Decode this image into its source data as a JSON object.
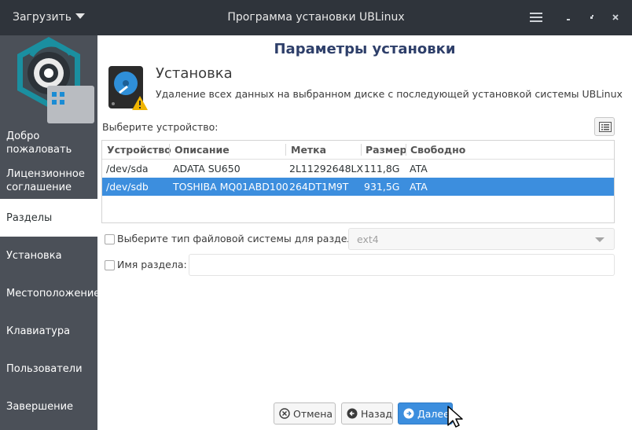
{
  "titlebar": {
    "load_menu": "Загрузить",
    "title": "Программа установки UBLinux",
    "minimize": "˯",
    "maximize": "˰",
    "close": "✕"
  },
  "sidebar": {
    "items": [
      {
        "label": "Добро\nпожаловать",
        "active": false
      },
      {
        "label": "Лицензионное\nсоглашение",
        "active": false
      },
      {
        "label": "Разделы",
        "active": true
      },
      {
        "label": "Установка",
        "active": false
      },
      {
        "label": "Местоположение",
        "active": false
      },
      {
        "label": "Клавиатура",
        "active": false
      },
      {
        "label": "Пользователи",
        "active": false
      },
      {
        "label": "Завершение",
        "active": false
      }
    ]
  },
  "main": {
    "title": "Параметры установки",
    "section_title": "Установка",
    "section_desc": "Удаление всех данных на выбранном диске с последующей установкой системы UBLinux",
    "choose_device_label": "Выберите устройство:"
  },
  "table": {
    "columns": [
      "Устройство",
      "Описание",
      "Метка",
      "Размер",
      "Свободно"
    ],
    "rows": [
      {
        "device": "/dev/sda",
        "description": "ADATA SU650",
        "label": "2L11292648LX",
        "size": "111,8G",
        "free": "ATA",
        "selected": false
      },
      {
        "device": "/dev/sdb",
        "description": "TOSHIBA MQ01ABD100",
        "label": "264DT1M9T",
        "size": "931,5G",
        "free": "ATA",
        "selected": true
      }
    ]
  },
  "options": {
    "fs_type_label": "Выберите тип файловой системы для раздела",
    "fs_type_value": "ext4",
    "partition_name_label": "Имя раздела:",
    "partition_name_value": ""
  },
  "buttons": {
    "cancel": "Отмена",
    "back": "Назад",
    "next": "Далее"
  },
  "colors": {
    "titlebar_bg": "#2f343b",
    "sidebar_bg": "#4b5058",
    "accent": "#3c8ede",
    "logo_teal": "#1a8fa0"
  }
}
